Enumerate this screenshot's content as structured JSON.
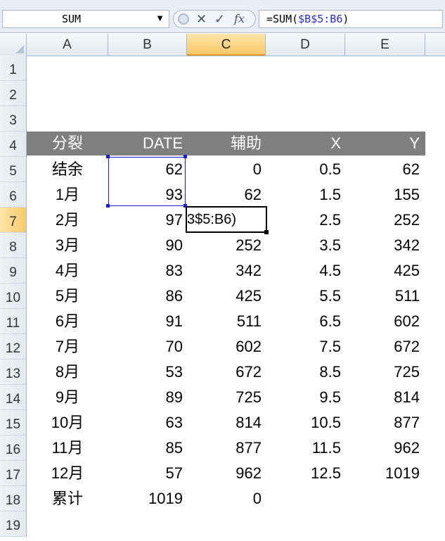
{
  "formula_bar": {
    "name_box": "SUM",
    "formula_prefix": "=SUM(",
    "formula_ref": "$B$5:B6",
    "formula_suffix": ")",
    "cancel_glyph": "✕",
    "enter_glyph": "✓",
    "fx_glyph": "fx"
  },
  "columns": [
    "A",
    "B",
    "C",
    "D",
    "E"
  ],
  "rows": [
    "1",
    "2",
    "3",
    "4",
    "5",
    "6",
    "7",
    "8",
    "9",
    "10",
    "11",
    "12",
    "13",
    "14",
    "15",
    "16",
    "17",
    "18",
    "19"
  ],
  "table": {
    "headers": [
      "分裂",
      "DATE",
      "辅助",
      "X",
      "Y"
    ],
    "rows": [
      [
        "结余",
        "62",
        "0",
        "0.5",
        "62"
      ],
      [
        "1月",
        "93",
        "62",
        "1.5",
        "155"
      ],
      [
        "2月",
        "97",
        "",
        "2.5",
        "252"
      ],
      [
        "3月",
        "90",
        "252",
        "3.5",
        "342"
      ],
      [
        "4月",
        "83",
        "342",
        "4.5",
        "425"
      ],
      [
        "5月",
        "86",
        "425",
        "5.5",
        "511"
      ],
      [
        "6月",
        "91",
        "511",
        "6.5",
        "602"
      ],
      [
        "7月",
        "70",
        "602",
        "7.5",
        "672"
      ],
      [
        "8月",
        "53",
        "672",
        "8.5",
        "725"
      ],
      [
        "9月",
        "89",
        "725",
        "9.5",
        "814"
      ],
      [
        "10月",
        "63",
        "814",
        "10.5",
        "877"
      ],
      [
        "11月",
        "85",
        "877",
        "11.5",
        "962"
      ],
      [
        "12月",
        "57",
        "962",
        "12.5",
        "1019"
      ],
      [
        "累计",
        "1019",
        "0",
        "",
        ""
      ]
    ]
  },
  "active_cell": {
    "ref": "C7",
    "display_text": "3$5:B6)"
  },
  "colors": {
    "header_band": "#7f7f7f",
    "selection_border": "#1a1adb",
    "formula_ref": "#2a2ad6",
    "active_header": "#f8c96a"
  }
}
